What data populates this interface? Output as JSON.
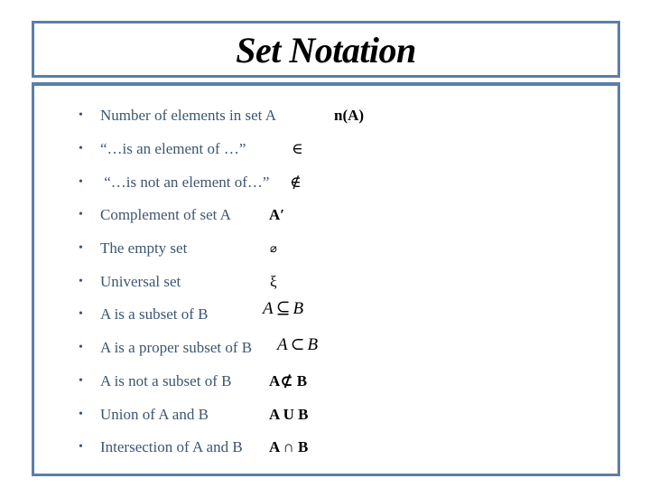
{
  "title": "Set Notation",
  "colors": {
    "border": "#5b7fa8",
    "label_text": "#3d5670",
    "symbol_text": "#000000"
  },
  "items": [
    {
      "label": "Number of elements in set A",
      "symbol": "n(A)"
    },
    {
      "label": "“…is an element of …”",
      "symbol": "∈"
    },
    {
      "label": " “…is not an element of…”",
      "symbol": "∉"
    },
    {
      "label": "Complement of set A",
      "symbol": "A′"
    },
    {
      "label": "The empty set",
      "symbol": "⌀"
    },
    {
      "label": "Universal set",
      "symbol": "ξ"
    },
    {
      "label": "A is a subset of B",
      "symbol_parts": [
        "A",
        "⊆",
        "B"
      ]
    },
    {
      "label": "A is a proper subset of B",
      "symbol_parts": [
        "A",
        "⊂",
        "B"
      ]
    },
    {
      "label": "A is not a subset of B",
      "symbol": "A⊄ B"
    },
    {
      "label": "Union of A and B",
      "symbol": "A U B"
    },
    {
      "label": "Intersection of A and B",
      "symbol": "A ∩ B"
    }
  ],
  "bullet": "•"
}
